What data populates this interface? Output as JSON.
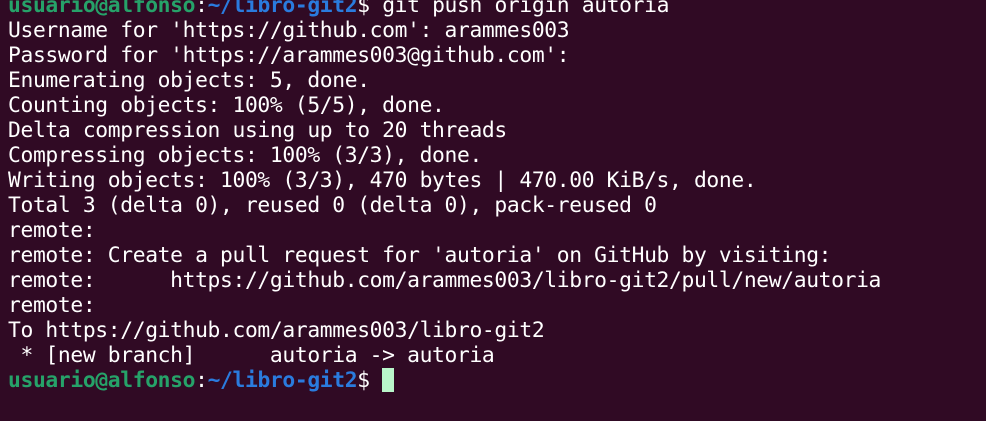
{
  "prompt": {
    "user_host": "usuario@alfonso",
    "separator": ":",
    "path": "~/libro-git2",
    "symbol": "$"
  },
  "command": "git push origin autoria",
  "output_lines": [
    "Username for 'https://github.com': arammes003",
    "Password for 'https://arammes003@github.com':",
    "Enumerating objects: 5, done.",
    "Counting objects: 100% (5/5), done.",
    "Delta compression using up to 20 threads",
    "Compressing objects: 100% (3/3), done.",
    "Writing objects: 100% (3/3), 470 bytes | 470.00 KiB/s, done.",
    "Total 3 (delta 0), reused 0 (delta 0), pack-reused 0",
    "remote:",
    "remote: Create a pull request for 'autoria' on GitHub by visiting:",
    "remote:      https://github.com/arammes003/libro-git2/pull/new/autoria",
    "remote:",
    "To https://github.com/arammes003/libro-git2",
    " * [new branch]      autoria -> autoria"
  ],
  "colors": {
    "background": "#300a24",
    "user_host": "#26a269",
    "path": "#2a7bde",
    "text": "#ffffff",
    "cursor": "#b9f6ca"
  }
}
